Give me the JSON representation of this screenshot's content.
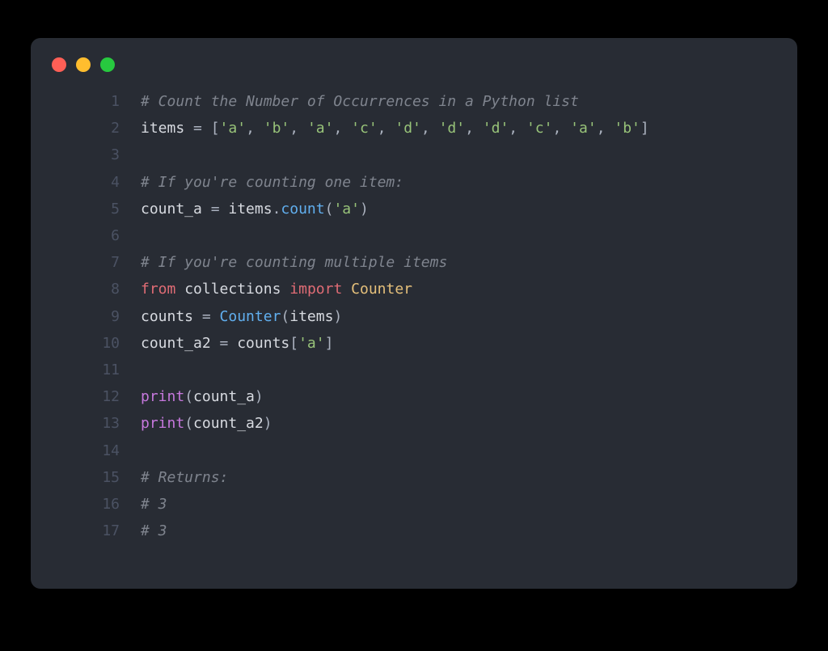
{
  "window_title": "code snippet",
  "traffic_lights": {
    "red": "close",
    "yellow": "minimize",
    "green": "zoom"
  },
  "colors": {
    "background": "#282c34",
    "gutter": "#4b5263",
    "default": "#abb2bf",
    "comment": "#7f848e",
    "string": "#98c379",
    "function": "#61afef",
    "attr": "#e5c07b",
    "keyword": "#c678dd",
    "keyword2": "#e06c75",
    "builtin": "#56b6c2"
  },
  "lines": [
    {
      "n": "1",
      "tokens": [
        {
          "cls": "tok-comment",
          "t": "# Count the Number of Occurrences in a Python list"
        }
      ]
    },
    {
      "n": "2",
      "tokens": [
        {
          "cls": "tok-ident",
          "t": "items"
        },
        {
          "cls": "tok-op",
          "t": " = "
        },
        {
          "cls": "tok-punct",
          "t": "["
        },
        {
          "cls": "tok-string",
          "t": "'a'"
        },
        {
          "cls": "tok-punct",
          "t": ", "
        },
        {
          "cls": "tok-string",
          "t": "'b'"
        },
        {
          "cls": "tok-punct",
          "t": ", "
        },
        {
          "cls": "tok-string",
          "t": "'a'"
        },
        {
          "cls": "tok-punct",
          "t": ", "
        },
        {
          "cls": "tok-string",
          "t": "'c'"
        },
        {
          "cls": "tok-punct",
          "t": ", "
        },
        {
          "cls": "tok-string",
          "t": "'d'"
        },
        {
          "cls": "tok-punct",
          "t": ", "
        },
        {
          "cls": "tok-string",
          "t": "'d'"
        },
        {
          "cls": "tok-punct",
          "t": ", "
        },
        {
          "cls": "tok-string",
          "t": "'d'"
        },
        {
          "cls": "tok-punct",
          "t": ", "
        },
        {
          "cls": "tok-string",
          "t": "'c'"
        },
        {
          "cls": "tok-punct",
          "t": ", "
        },
        {
          "cls": "tok-string",
          "t": "'a'"
        },
        {
          "cls": "tok-punct",
          "t": ", "
        },
        {
          "cls": "tok-string",
          "t": "'b'"
        },
        {
          "cls": "tok-punct",
          "t": "]"
        }
      ]
    },
    {
      "n": "3",
      "tokens": [
        {
          "cls": "tok-punct",
          "t": ""
        }
      ]
    },
    {
      "n": "4",
      "tokens": [
        {
          "cls": "tok-comment",
          "t": "# If you're counting one item:"
        }
      ]
    },
    {
      "n": "5",
      "tokens": [
        {
          "cls": "tok-ident",
          "t": "count_a"
        },
        {
          "cls": "tok-op",
          "t": " = "
        },
        {
          "cls": "tok-ident",
          "t": "items"
        },
        {
          "cls": "tok-punct",
          "t": "."
        },
        {
          "cls": "tok-func",
          "t": "count"
        },
        {
          "cls": "tok-punct",
          "t": "("
        },
        {
          "cls": "tok-string",
          "t": "'a'"
        },
        {
          "cls": "tok-punct",
          "t": ")"
        }
      ]
    },
    {
      "n": "6",
      "tokens": [
        {
          "cls": "tok-punct",
          "t": ""
        }
      ]
    },
    {
      "n": "7",
      "tokens": [
        {
          "cls": "tok-comment",
          "t": "# If you're counting multiple items"
        }
      ]
    },
    {
      "n": "8",
      "tokens": [
        {
          "cls": "tok-keyword2",
          "t": "from"
        },
        {
          "cls": "tok-punct",
          "t": " "
        },
        {
          "cls": "tok-ident",
          "t": "collections"
        },
        {
          "cls": "tok-punct",
          "t": " "
        },
        {
          "cls": "tok-keyword2",
          "t": "import"
        },
        {
          "cls": "tok-punct",
          "t": " "
        },
        {
          "cls": "tok-attr",
          "t": "Counter"
        }
      ]
    },
    {
      "n": "9",
      "tokens": [
        {
          "cls": "tok-ident",
          "t": "counts"
        },
        {
          "cls": "tok-op",
          "t": " = "
        },
        {
          "cls": "tok-func",
          "t": "Counter"
        },
        {
          "cls": "tok-punct",
          "t": "("
        },
        {
          "cls": "tok-ident",
          "t": "items"
        },
        {
          "cls": "tok-punct",
          "t": ")"
        }
      ]
    },
    {
      "n": "10",
      "tokens": [
        {
          "cls": "tok-ident",
          "t": "count_a2"
        },
        {
          "cls": "tok-op",
          "t": " = "
        },
        {
          "cls": "tok-ident",
          "t": "counts"
        },
        {
          "cls": "tok-punct",
          "t": "["
        },
        {
          "cls": "tok-string",
          "t": "'a'"
        },
        {
          "cls": "tok-punct",
          "t": "]"
        }
      ]
    },
    {
      "n": "11",
      "tokens": [
        {
          "cls": "tok-punct",
          "t": ""
        }
      ]
    },
    {
      "n": "12",
      "tokens": [
        {
          "cls": "tok-keyword",
          "t": "print"
        },
        {
          "cls": "tok-punct",
          "t": "("
        },
        {
          "cls": "tok-ident",
          "t": "count_a"
        },
        {
          "cls": "tok-punct",
          "t": ")"
        }
      ]
    },
    {
      "n": "13",
      "tokens": [
        {
          "cls": "tok-keyword",
          "t": "print"
        },
        {
          "cls": "tok-punct",
          "t": "("
        },
        {
          "cls": "tok-ident",
          "t": "count_a2"
        },
        {
          "cls": "tok-punct",
          "t": ")"
        }
      ]
    },
    {
      "n": "14",
      "tokens": [
        {
          "cls": "tok-punct",
          "t": ""
        }
      ]
    },
    {
      "n": "15",
      "tokens": [
        {
          "cls": "tok-comment",
          "t": "# Returns:"
        }
      ]
    },
    {
      "n": "16",
      "tokens": [
        {
          "cls": "tok-comment",
          "t": "# 3"
        }
      ]
    },
    {
      "n": "17",
      "tokens": [
        {
          "cls": "tok-comment",
          "t": "# 3"
        }
      ]
    }
  ]
}
